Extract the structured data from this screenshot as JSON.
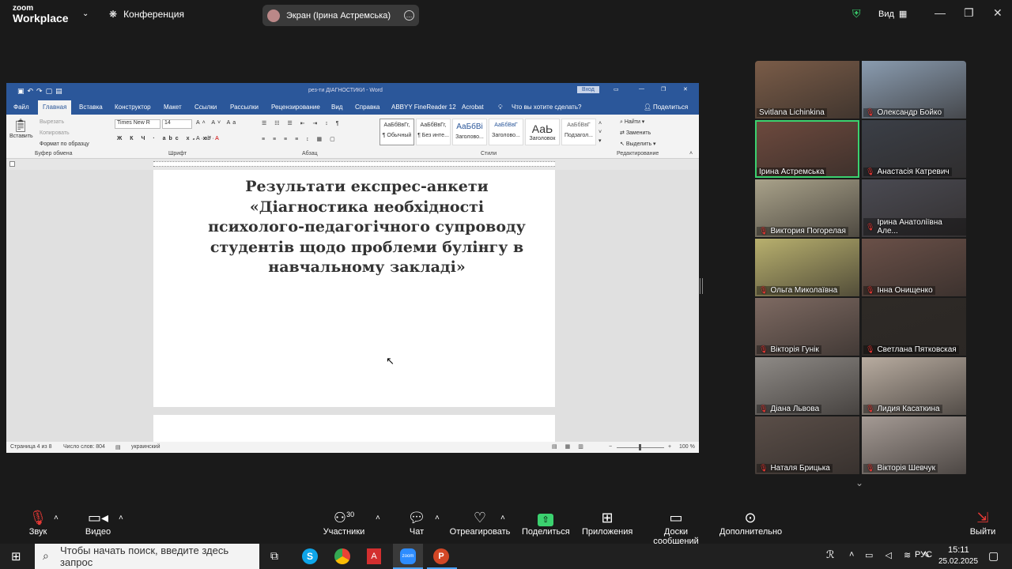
{
  "zoom": {
    "logo_top": "zoom",
    "logo_bottom": "Workplace",
    "meeting_label": "Конференция",
    "screen_share_label": "Экран (Ірина Астремська)",
    "view_label": "Вид"
  },
  "word": {
    "title": "рез-ти ДІАГНОСТИКИ  -  Word",
    "login": "Вход",
    "tabs": [
      "Файл",
      "Главная",
      "Вставка",
      "Конструктор",
      "Макет",
      "Ссылки",
      "Рассылки",
      "Рецензирование",
      "Вид",
      "Справка",
      "ABBYY FineReader 12",
      "Acrobat"
    ],
    "tell_me": "Что вы хотите сделать?",
    "share": "Поделиться",
    "clipboard": {
      "paste": "Вставить",
      "cut": "Вырезать",
      "copy": "Копировать",
      "format": "Формат по образцу",
      "group": "Буфер обмена"
    },
    "font": {
      "name": "Times New R",
      "size": "14",
      "group": "Шрифт"
    },
    "paragraph_group": "Абзац",
    "styles": [
      {
        "preview": "АаБбВвГг,",
        "name": "¶ Обычный"
      },
      {
        "preview": "АаБбВвГг,",
        "name": "¶ Без инте..."
      },
      {
        "preview": "АаБбВі",
        "name": "Заголово..."
      },
      {
        "preview": "АаБбВвГ",
        "name": "Заголово..."
      },
      {
        "preview": "АаЬ",
        "name": "Заголовок"
      },
      {
        "preview": "АаБбВвГ",
        "name": "Подзагол..."
      }
    ],
    "styles_group": "Стили",
    "editing": {
      "find": "Найти",
      "replace": "Заменить",
      "select": "Выделить",
      "group": "Редактирование"
    },
    "document_title": "Результати експрес-анкети «Діагностика необхідності психолого-педагогічного супроводу студентів щодо проблеми булінгу в навчальному закладі»",
    "status": {
      "page": "Страница 4 из 8",
      "words": "Число слов: 804",
      "lang": "украинский",
      "zoom": "100 %"
    }
  },
  "participants": [
    {
      "name": "Svitlana Lichinkina",
      "muted": false,
      "speaking": false,
      "color": "#7a5c48"
    },
    {
      "name": "Олександр Бойко",
      "muted": true,
      "speaking": false,
      "color": "#8a9cb0"
    },
    {
      "name": "Ірина Астремська",
      "muted": false,
      "speaking": true,
      "color": "#6e4a3e"
    },
    {
      "name": "Анастасія Катревич",
      "muted": true,
      "speaking": false,
      "color": "#3b3f47"
    },
    {
      "name": "Виктория Погорелая",
      "muted": true,
      "speaking": false,
      "color": "#a9a28a"
    },
    {
      "name": "Ірина Анатоліївна Але...",
      "muted": true,
      "speaking": false,
      "color": "#4a4a52"
    },
    {
      "name": "Ольга Миколаївна",
      "muted": true,
      "speaking": false,
      "color": "#b8b06e"
    },
    {
      "name": "Інна Онищенко",
      "muted": true,
      "speaking": false,
      "color": "#6a5048"
    },
    {
      "name": "Вікторія Гунік",
      "muted": true,
      "speaking": false,
      "color": "#7e6a62"
    },
    {
      "name": "Светлана Пятковская",
      "muted": true,
      "speaking": false,
      "color": "#2e2a26"
    },
    {
      "name": "Діана Львова",
      "muted": true,
      "speaking": false,
      "color": "#8e8a86"
    },
    {
      "name": "Лидия Касаткина",
      "muted": true,
      "speaking": false,
      "color": "#b8aca0"
    },
    {
      "name": "Наталя Брицька",
      "muted": true,
      "speaking": false,
      "color": "#5a4e48"
    },
    {
      "name": "Вікторія Шевчук",
      "muted": true,
      "speaking": false,
      "color": "#a49a94"
    }
  ],
  "toolbar": {
    "audio": "Звук",
    "video": "Видео",
    "participants": "Участники",
    "participants_count": "30",
    "chat": "Чат",
    "react": "Отреагировать",
    "share": "Поделиться",
    "apps": "Приложения",
    "whiteboards": "Доски сообщений",
    "more": "Дополнительно",
    "leave": "Выйти"
  },
  "taskbar": {
    "search_placeholder": "Чтобы начать поиск, введите здесь запрос",
    "lang": "РУС",
    "time": "15:11",
    "date": "25.02.2025"
  },
  "colors": {
    "zoom_bg": "#1a1a1a",
    "word_blue": "#2b579a",
    "speaker": "#3bd16f",
    "share_green": "#3bd16f",
    "mute_red": "#e53935"
  }
}
